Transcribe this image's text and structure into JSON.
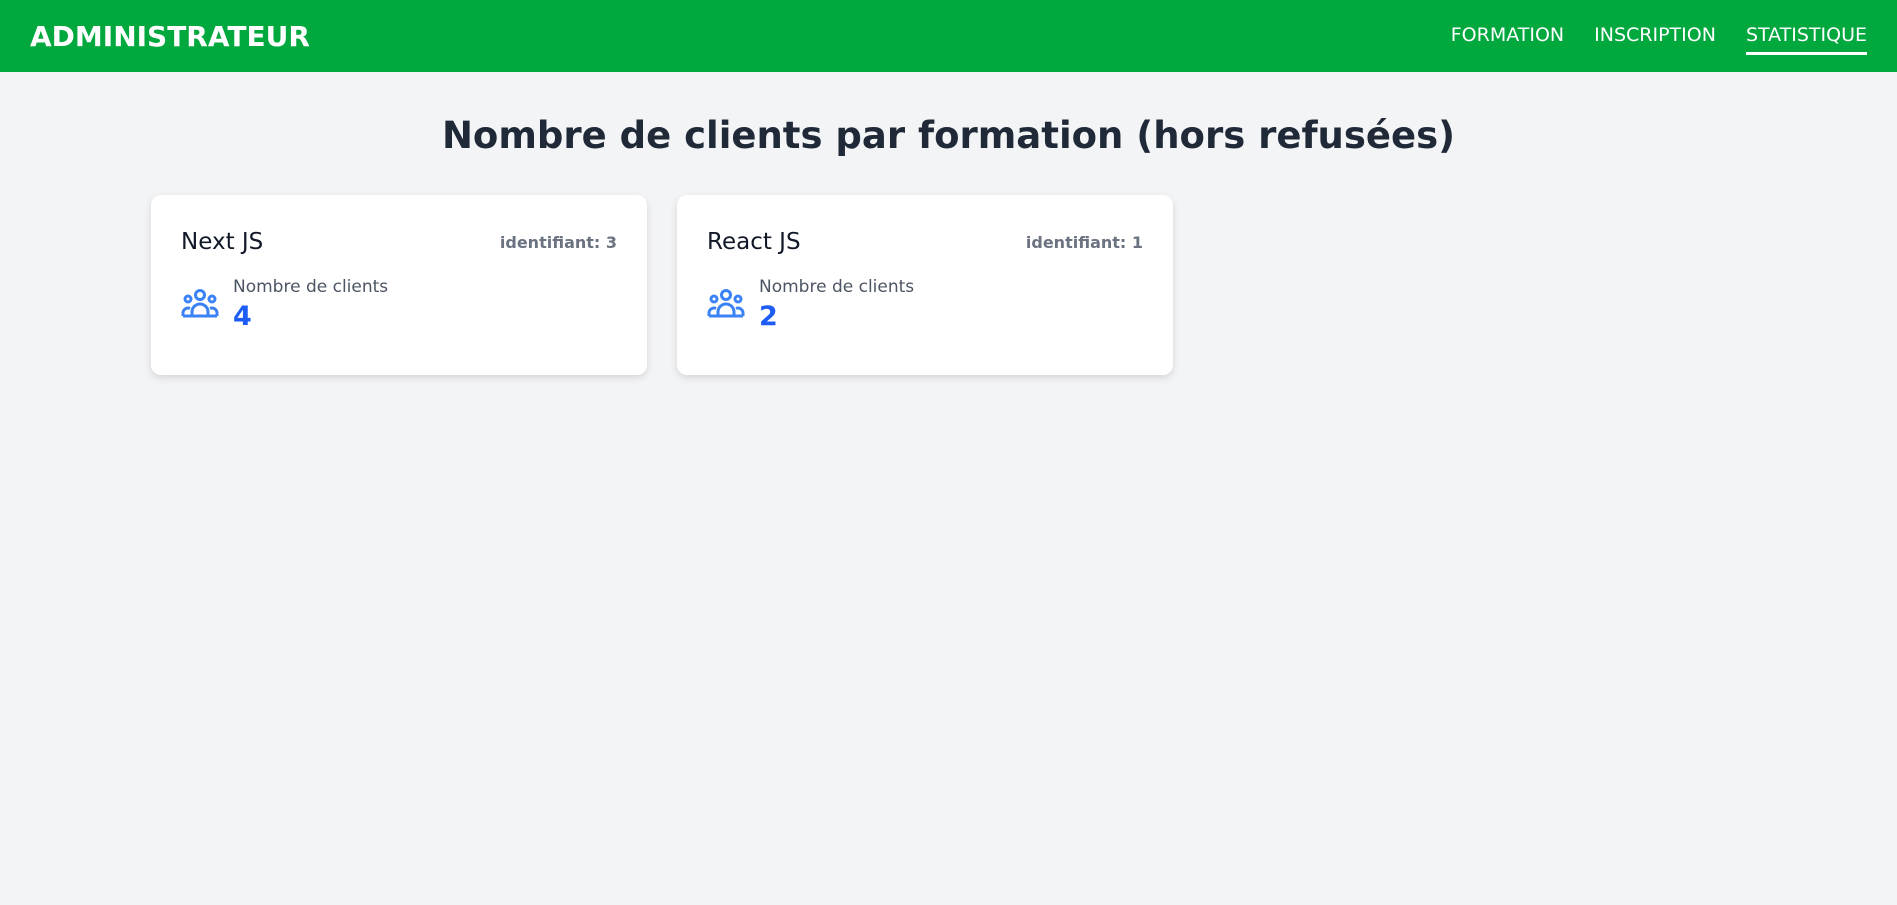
{
  "nav": {
    "brand": "ADMINISTRATEUR",
    "links": [
      {
        "label": "FORMATION",
        "active": false
      },
      {
        "label": "INSCRIPTION",
        "active": false
      },
      {
        "label": "STATISTIQUE",
        "active": true
      }
    ]
  },
  "page": {
    "title": "Nombre de clients par formation (hors refusées)"
  },
  "cards": [
    {
      "title": "Next JS",
      "id_label": "identifiant: 3",
      "count_label": "Nombre de clients",
      "count": "4"
    },
    {
      "title": "React JS",
      "id_label": "identifiant: 1",
      "count_label": "Nombre de clients",
      "count": "2"
    }
  ],
  "colors": {
    "nav": "#00a83e",
    "accent": "#1d5cf5",
    "icon": "#3b82f6"
  },
  "icons": {
    "card": "users-group-icon"
  }
}
